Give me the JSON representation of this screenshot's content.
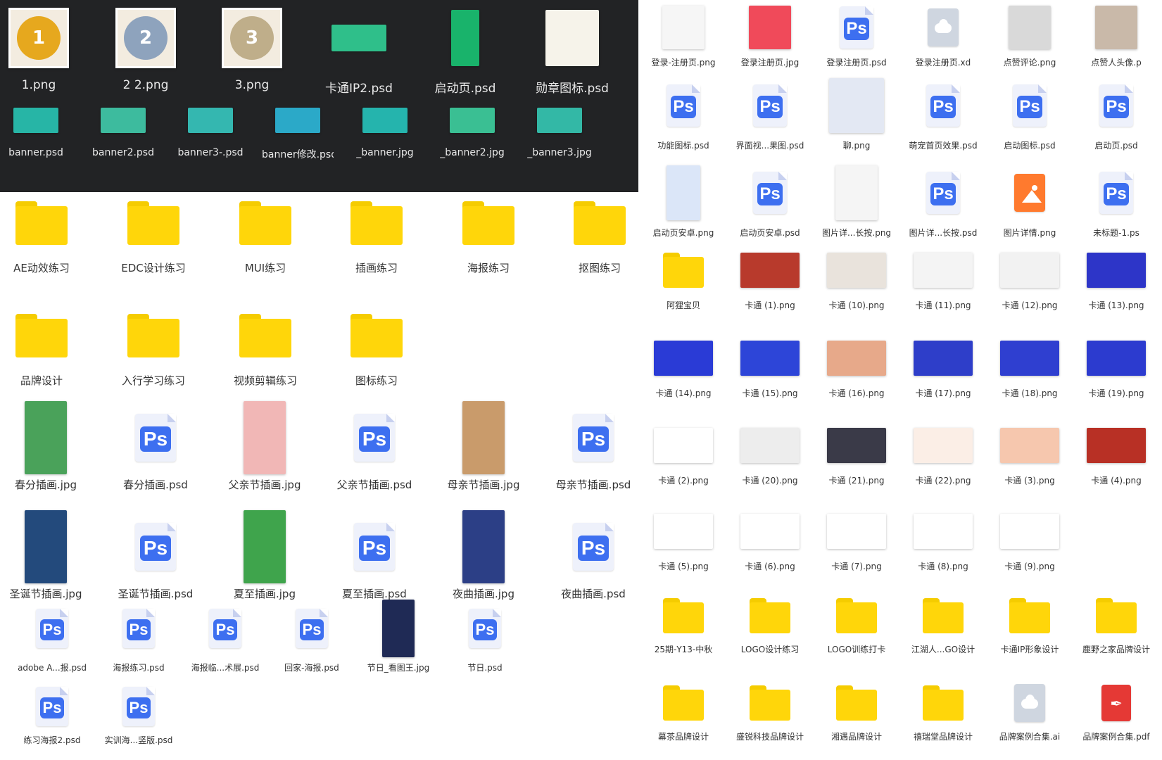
{
  "dark_row1": [
    {
      "name": "1.png",
      "kind": "medal",
      "color": "#e6a81e"
    },
    {
      "name": "2 2.png",
      "kind": "medal",
      "color": "#8ea3bd"
    },
    {
      "name": "3.png",
      "kind": "medal",
      "color": "#bfae8a"
    },
    {
      "name": "卡通IP2.psd",
      "kind": "img",
      "color": "#2fbf8a"
    },
    {
      "name": "启动页.psd",
      "kind": "img",
      "color": "#19b36b"
    },
    {
      "name": "勋章图标.psd",
      "kind": "img",
      "color": "#f6f3ea"
    }
  ],
  "dark_row2": [
    {
      "name": "banner.psd",
      "color": "#27b5a6"
    },
    {
      "name": "banner2.psd",
      "color": "#3dbb9e"
    },
    {
      "name": "banner3-.psd",
      "color": "#34b7b0"
    },
    {
      "name": "banner修改.psd",
      "color": "#2ba9c8"
    },
    {
      "name": "_banner.jpg",
      "color": "#25b4ad"
    },
    {
      "name": "_banner2.jpg",
      "color": "#3abf93"
    },
    {
      "name": "_banner3.jpg",
      "color": "#33b8a6"
    }
  ],
  "left_folders_row1": [
    "AE动效练习",
    "EDC设计练习",
    "MUI练习",
    "插画练习",
    "海报练习",
    "抠图练习"
  ],
  "left_folders_row2": [
    "品牌设计",
    "入行学习练习",
    "视频剪辑练习",
    "图标练习"
  ],
  "left_files_row3": [
    {
      "name": "春分插画.jpg",
      "kind": "img",
      "color": "#4aa25a"
    },
    {
      "name": "春分插画.psd",
      "kind": "ps"
    },
    {
      "name": "父亲节插画.jpg",
      "kind": "img",
      "color": "#f1b7b6"
    },
    {
      "name": "父亲节插画.psd",
      "kind": "ps"
    },
    {
      "name": "母亲节插画.jpg",
      "kind": "img",
      "color": "#c99b6b"
    },
    {
      "name": "母亲节插画.psd",
      "kind": "ps"
    }
  ],
  "left_files_row4": [
    {
      "name": "圣诞节插画.jpg",
      "kind": "img",
      "color": "#234a7c"
    },
    {
      "name": "圣诞节插画.psd",
      "kind": "ps"
    },
    {
      "name": "夏至插画.jpg",
      "kind": "img",
      "color": "#3fa44c"
    },
    {
      "name": "夏至插画.psd",
      "kind": "ps"
    },
    {
      "name": "夜曲插画.jpg",
      "kind": "img",
      "color": "#2c3f86"
    },
    {
      "name": "夜曲插画.psd",
      "kind": "ps"
    }
  ],
  "left_files_row5": [
    {
      "name": "adobe A...报.psd",
      "kind": "ps"
    },
    {
      "name": "海报练习.psd",
      "kind": "ps"
    },
    {
      "name": "海报临...术展.psd",
      "kind": "ps"
    },
    {
      "name": "回家-海报.psd",
      "kind": "ps"
    },
    {
      "name": "节日_看图王.jpg",
      "kind": "img",
      "color": "#1f2a55"
    },
    {
      "name": "节日.psd",
      "kind": "ps"
    }
  ],
  "left_files_row6": [
    {
      "name": "练习海报2.psd",
      "kind": "ps"
    },
    {
      "name": "实训海...竖版.psd",
      "kind": "ps"
    }
  ],
  "right_rows": [
    [
      {
        "name": "登录-注册页.png",
        "kind": "img",
        "color": "#f6f6f6"
      },
      {
        "name": "登录注册页.jpg",
        "kind": "img",
        "color": "#f04a5a"
      },
      {
        "name": "登录注册页.psd",
        "kind": "ps"
      },
      {
        "name": "登录注册页.xd",
        "kind": "cloud"
      },
      {
        "name": "点赞评论.png",
        "kind": "img",
        "color": "#d9d9d9"
      },
      {
        "name": "点赞人头像.p",
        "kind": "img",
        "color": "#c9b9a9"
      }
    ],
    [
      {
        "name": "功能图标.psd",
        "kind": "ps"
      },
      {
        "name": "界面视...果图.psd",
        "kind": "ps"
      },
      {
        "name": "聊.png",
        "kind": "img",
        "color": "#e3e8f3"
      },
      {
        "name": "萌宠首页效果.psd",
        "kind": "ps"
      },
      {
        "name": "启动图标.psd",
        "kind": "ps"
      },
      {
        "name": "启动页.psd",
        "kind": "ps"
      }
    ],
    [
      {
        "name": "启动页安卓.png",
        "kind": "img",
        "color": "#dbe6f8"
      },
      {
        "name": "启动页安卓.psd",
        "kind": "ps"
      },
      {
        "name": "图片详...长按.png",
        "kind": "img",
        "color": "#f5f5f5"
      },
      {
        "name": "图片详...长按.psd",
        "kind": "ps"
      },
      {
        "name": "图片详情.png",
        "kind": "imgicon"
      },
      {
        "name": "未标题-1.ps",
        "kind": "ps"
      }
    ],
    [
      {
        "name": "阿狸宝贝",
        "kind": "folder"
      },
      {
        "name": "卡通 (1).png",
        "kind": "img",
        "color": "#b83a2c"
      },
      {
        "name": "卡通 (10).png",
        "kind": "img",
        "color": "#e9e3dc"
      },
      {
        "name": "卡通 (11).png",
        "kind": "img",
        "color": "#f4f4f4"
      },
      {
        "name": "卡通 (12).png",
        "kind": "img",
        "color": "#f2f2f2"
      },
      {
        "name": "卡通 (13).png",
        "kind": "img",
        "color": "#2d35c8"
      }
    ],
    [
      {
        "name": "卡通 (14).png",
        "kind": "img",
        "color": "#2a3bd6"
      },
      {
        "name": "卡通 (15).png",
        "kind": "img",
        "color": "#2d45d8"
      },
      {
        "name": "卡通 (16).png",
        "kind": "img",
        "color": "#e7a98a"
      },
      {
        "name": "卡通 (17).png",
        "kind": "img",
        "color": "#2e3ec9"
      },
      {
        "name": "卡通 (18).png",
        "kind": "img",
        "color": "#2f3fd0"
      },
      {
        "name": "卡通 (19).png",
        "kind": "img",
        "color": "#2c3bcf"
      }
    ],
    [
      {
        "name": "卡通 (2).png",
        "kind": "img",
        "color": "#ffffff"
      },
      {
        "name": "卡通 (20).png",
        "kind": "img",
        "color": "#ededed"
      },
      {
        "name": "卡通 (21).png",
        "kind": "img",
        "color": "#3a3a48"
      },
      {
        "name": "卡通 (22).png",
        "kind": "img",
        "color": "#fbeee6"
      },
      {
        "name": "卡通 (3).png",
        "kind": "img",
        "color": "#f6c7ae"
      },
      {
        "name": "卡通 (4).png",
        "kind": "img",
        "color": "#b83025"
      }
    ],
    [
      {
        "name": "卡通 (5).png",
        "kind": "img",
        "color": "#ffffff"
      },
      {
        "name": "卡通 (6).png",
        "kind": "img",
        "color": "#ffffff"
      },
      {
        "name": "卡通 (7).png",
        "kind": "img",
        "color": "#ffffff"
      },
      {
        "name": "卡通 (8).png",
        "kind": "img",
        "color": "#ffffff"
      },
      {
        "name": "卡通 (9).png",
        "kind": "img",
        "color": "#ffffff"
      }
    ],
    [
      {
        "name": "25期-Y13-中秋",
        "kind": "folder"
      },
      {
        "name": "LOGO设计练习",
        "kind": "folder"
      },
      {
        "name": "LOGO训练打卡",
        "kind": "folder"
      },
      {
        "name": "江湖人...GO设计",
        "kind": "folder"
      },
      {
        "name": "卡通IP形象设计",
        "kind": "folder"
      },
      {
        "name": "鹿野之家品牌设计",
        "kind": "folder"
      }
    ],
    [
      {
        "name": "幕茶品牌设计",
        "kind": "folder"
      },
      {
        "name": "盛锐科技品牌设计",
        "kind": "folder"
      },
      {
        "name": "湘遇品牌设计",
        "kind": "folder"
      },
      {
        "name": "禧瑞堂品牌设计",
        "kind": "folder"
      },
      {
        "name": "品牌案例合集.ai",
        "kind": "cloud"
      },
      {
        "name": "品牌案例合集.pdf",
        "kind": "pdf"
      }
    ]
  ],
  "ps_text": "Ps",
  "medal_numbers": [
    "1",
    "2",
    "3"
  ],
  "colors": {
    "folder": "#ffd60a",
    "ps_badge": "#3d6ff0",
    "dark_bg": "#222325"
  }
}
